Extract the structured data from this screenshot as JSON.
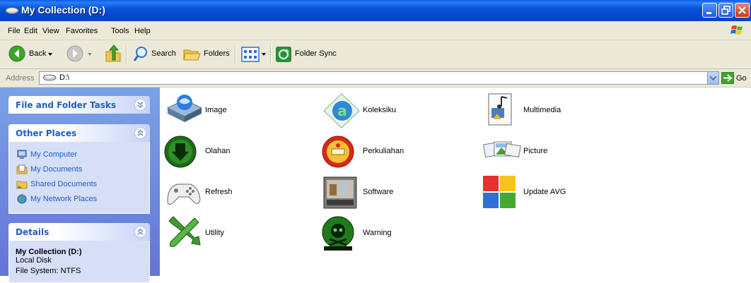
{
  "window": {
    "title": "My Collection (D:)"
  },
  "menu": [
    "File",
    "Edit",
    "View",
    "Favorites",
    "Tools",
    "Help"
  ],
  "toolbar": {
    "back": "Back",
    "search": "Search",
    "folders": "Folders",
    "sync": "Folder Sync"
  },
  "address": {
    "label": "Address",
    "value": "D:\\",
    "go": "Go"
  },
  "tasks": {
    "file_folder": {
      "title": "File and Folder Tasks"
    },
    "other_places": {
      "title": "Other Places",
      "items": [
        "My Computer",
        "My Documents",
        "Shared Documents",
        "My Network Places"
      ]
    },
    "details": {
      "title": "Details",
      "name": "My Collection (D:)",
      "type": "Local Disk",
      "fs": "File System: NTFS"
    }
  },
  "items": [
    {
      "label": "Image",
      "icon": "image-folder-icon"
    },
    {
      "label": "Koleksiku",
      "icon": "koleksiku-icon"
    },
    {
      "label": "Multimedia",
      "icon": "multimedia-icon"
    },
    {
      "label": "Olahan",
      "icon": "download-arrow-icon"
    },
    {
      "label": "Perkuliahan",
      "icon": "stmik-seal-icon"
    },
    {
      "label": "Picture",
      "icon": "pictures-icon"
    },
    {
      "label": "Refresh",
      "icon": "gamepad-icon"
    },
    {
      "label": "Software",
      "icon": "software-box-icon"
    },
    {
      "label": "Update AVG",
      "icon": "avg-icon"
    },
    {
      "label": "Utility",
      "icon": "tools-icon"
    },
    {
      "label": "Warning",
      "icon": "skull-warning-icon"
    }
  ]
}
